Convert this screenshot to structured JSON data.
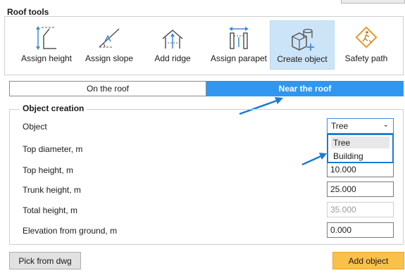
{
  "panel": {
    "title": "Roof tools"
  },
  "tools": [
    {
      "label": "Assign height",
      "icon": "assign-height-icon"
    },
    {
      "label": "Assign slope",
      "icon": "assign-slope-icon"
    },
    {
      "label": "Add ridge",
      "icon": "add-ridge-icon"
    },
    {
      "label": "Assign parapet",
      "icon": "assign-parapet-icon"
    },
    {
      "label": "Create object",
      "icon": "create-object-icon",
      "active": true
    },
    {
      "label": "Safety path",
      "icon": "safety-path-icon"
    }
  ],
  "mode_tabs": {
    "on_roof": "On the roof",
    "near_roof": "Near the roof",
    "selected": "near_roof"
  },
  "object_creation": {
    "title": "Object creation",
    "object_label": "Object",
    "object_value": "Tree",
    "object_options": [
      "Tree",
      "Building"
    ],
    "fields": [
      {
        "label": "Top diameter, m",
        "value": ""
      },
      {
        "label": "Top height, m",
        "value": "10.000"
      },
      {
        "label": "Trunk height, m",
        "value": "25.000"
      },
      {
        "label": "Total height, m",
        "value": "35.000",
        "disabled": true
      },
      {
        "label": "Elevation from ground, m",
        "value": "0.000"
      }
    ]
  },
  "buttons": {
    "pick_from_dwg": "Pick from dwg",
    "add_object": "Add object"
  },
  "colors": {
    "accent": "#2f97f0",
    "tool_active_bg": "#cce4f7",
    "add_button": "#f9c04a",
    "annotation_arrow": "#1c7bd2",
    "icon_blue": "#3a8ad8"
  }
}
